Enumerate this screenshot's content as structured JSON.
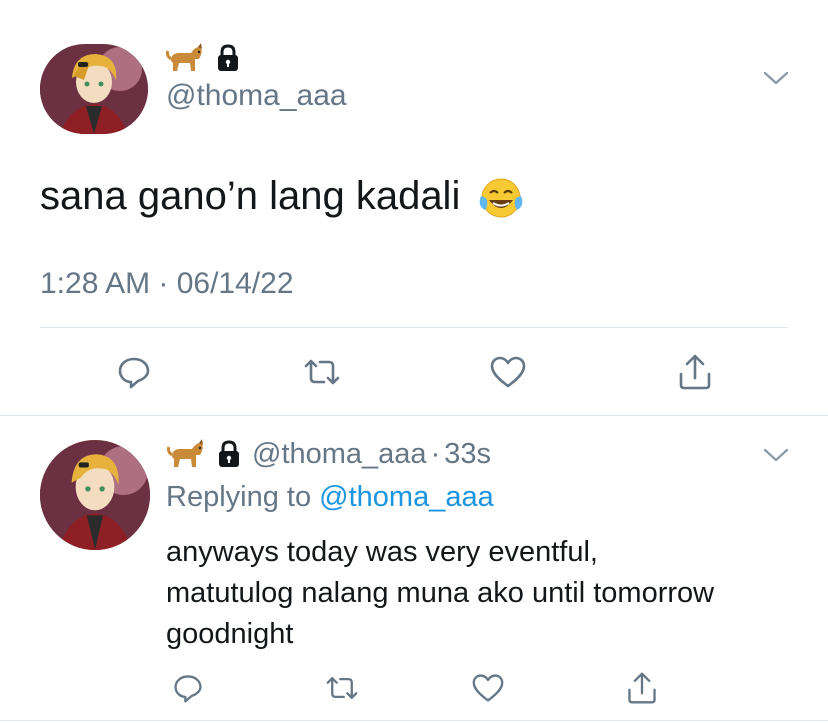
{
  "colors": {
    "text": "#14171a",
    "muted": "#657786",
    "link": "#1b95e0",
    "divider": "#e1e8ed",
    "background": "#ffffff"
  },
  "main_tweet": {
    "emoji_display": "dog-emoji, lock-icon",
    "handle": "@thoma_aaa",
    "text": "sana gano’n lang kadali",
    "text_emoji": "face-with-tears-of-joy",
    "timestamp": "1:28 AM · 06/14/22",
    "actions": [
      "reply-icon",
      "retweet-icon",
      "like-icon",
      "share-icon"
    ]
  },
  "reply_tweet": {
    "handle": "@thoma_aaa",
    "separator": "·",
    "time": "33s",
    "replying_prefix": "Replying to",
    "replying_handle": "@thoma_aaa",
    "text_line1": "anyways today was very eventful,",
    "text_line2": "matutulog nalang muna ako until tomorrow",
    "text_line3": "goodnight",
    "actions": [
      "reply-icon",
      "retweet-icon",
      "like-icon",
      "share-icon"
    ]
  }
}
